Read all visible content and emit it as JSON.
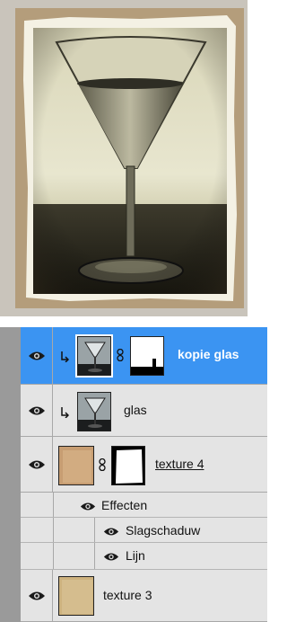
{
  "layers_panel": {
    "layers": [
      {
        "name": "kopie glas",
        "selected": true,
        "visible_icon": "eye-icon",
        "clipped": true,
        "has_mask": true
      },
      {
        "name": "glas",
        "selected": false,
        "visible_icon": "eye-icon",
        "clipped": true,
        "has_mask": false
      },
      {
        "name": "texture 4",
        "selected": false,
        "visible_icon": "eye-icon",
        "clipped": false,
        "has_mask": true,
        "underlined": true
      },
      {
        "name": "texture 3",
        "selected": false,
        "visible_icon": "eye-icon",
        "clipped": false,
        "has_mask": false
      }
    ],
    "effects_label": "Effecten",
    "effects": [
      "Slagschaduw",
      "Lijn"
    ]
  },
  "colors": {
    "selected_row": "#3b94f2",
    "panel_bg": "#e4e4e4",
    "left_strip": "#9a9a9a"
  }
}
